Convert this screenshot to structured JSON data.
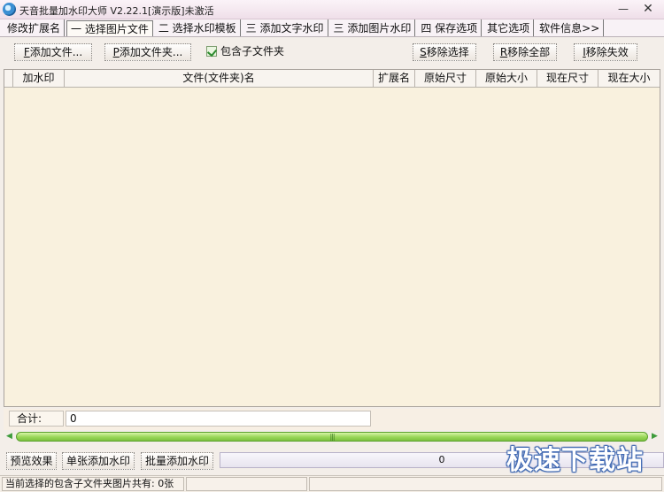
{
  "window": {
    "title": "天音批量加水印大师 V2.22.1[演示版]未激活",
    "minimize_icon": "minimize-icon",
    "close_icon": "close-icon"
  },
  "tabs": [
    {
      "label": "修改扩展名",
      "active": false
    },
    {
      "label": "一 选择图片文件",
      "active": true
    },
    {
      "label": "二 选择水印模板",
      "active": false
    },
    {
      "label": "三 添加文字水印",
      "active": false
    },
    {
      "label": "三 添加图片水印",
      "active": false
    },
    {
      "label": "四 保存选项",
      "active": false
    },
    {
      "label": "其它选项",
      "active": false
    },
    {
      "label": "软件信息>>",
      "active": false
    }
  ],
  "toolbar": {
    "add_file": {
      "hotkey": "F",
      "label": "添加文件..."
    },
    "add_folder": {
      "hotkey": "P",
      "label": "添加文件夹..."
    },
    "include_subfolders": "包含子文件夹",
    "remove_selected": {
      "hotkey": "S",
      "label": "移除选择"
    },
    "remove_all": {
      "hotkey": "R",
      "label": "移除全部"
    },
    "remove_invalid": {
      "hotkey": "I",
      "label": "移除失效"
    }
  },
  "grid": {
    "columns": [
      "加水印",
      "文件(文件夹)名",
      "扩展名",
      "原始尺寸",
      "原始大小",
      "现在尺寸",
      "现在大小"
    ],
    "rows": []
  },
  "summary": {
    "label": "合计:",
    "value": "0"
  },
  "actions": {
    "preview": "预览效果",
    "single": "单张添加水印",
    "batch": "批量添加水印",
    "progress_text": "0"
  },
  "status": {
    "message": "当前选择的包含子文件夹图片共有: 0张",
    "cell2": "",
    "cell3": ""
  },
  "watermark_logo": "极速下载站",
  "colors": {
    "grid_background": "#f9f1de",
    "scrollbar_green": "#97d657"
  }
}
